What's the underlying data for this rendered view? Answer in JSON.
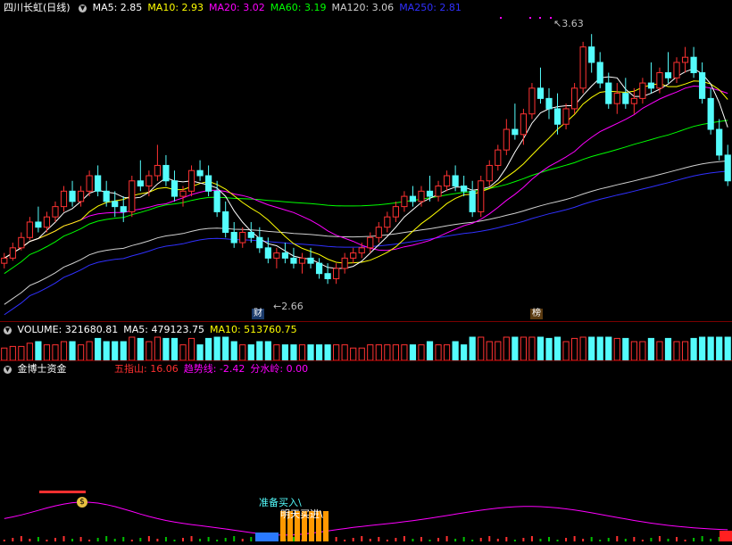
{
  "stock": {
    "name": "四川长虹",
    "period": "(日线)"
  },
  "price_legend": [
    {
      "label": "MA5: 2.85",
      "color": "#ffffff"
    },
    {
      "label": "MA10: 2.93",
      "color": "#ffff00"
    },
    {
      "label": "MA20: 3.02",
      "color": "#ff00ff"
    },
    {
      "label": "MA60: 3.19",
      "color": "#00ff00"
    },
    {
      "label": "MA120: 3.06",
      "color": "#d0d0d0"
    },
    {
      "label": "MA250: 2.81",
      "color": "#3030ff"
    }
  ],
  "volume_legend": [
    {
      "label": "VOLUME: 321680.81",
      "color": "#ffffff"
    },
    {
      "label": "MA5: 479123.75",
      "color": "#ffffff"
    },
    {
      "label": "MA10: 513760.75",
      "color": "#ffff00"
    }
  ],
  "indicator": {
    "name": "金博士资金",
    "items": [
      {
        "label": "五指山: 16.06",
        "color": "#ff3030"
      },
      {
        "label": "趋势线: -2.42",
        "color": "#ff00ff"
      },
      {
        "label": "分水岭: 0.00",
        "color": "#ff00ff"
      }
    ],
    "signals": {
      "prepare_buy": "准备买入",
      "tomorrow_buy": "明天买进"
    }
  },
  "annotations": {
    "high": "3.63",
    "low": "2.66",
    "badge_cai": "财",
    "badge_bang": "榜"
  },
  "colors": {
    "up": "#ff3232",
    "down": "#54fcfc",
    "background": "#000000"
  },
  "chart_data": {
    "type": "candlestick",
    "high_label": 3.63,
    "low_label": 2.66,
    "ma_last": {
      "MA5": 2.85,
      "MA10": 2.93,
      "MA20": 3.02,
      "MA60": 3.19,
      "MA120": 3.06,
      "MA250": 2.81
    },
    "volume_last": 321680.81,
    "volume_ma5": 479123.75,
    "volume_ma10": 513760.75,
    "candles": [
      [
        2.74,
        2.78,
        2.72,
        2.76
      ],
      [
        2.76,
        2.82,
        2.75,
        2.8
      ],
      [
        2.8,
        2.86,
        2.79,
        2.84
      ],
      [
        2.84,
        2.92,
        2.83,
        2.9
      ],
      [
        2.9,
        2.96,
        2.86,
        2.88
      ],
      [
        2.88,
        2.94,
        2.86,
        2.92
      ],
      [
        2.92,
        2.98,
        2.9,
        2.96
      ],
      [
        2.96,
        3.04,
        2.94,
        3.02
      ],
      [
        3.02,
        3.06,
        2.96,
        2.98
      ],
      [
        2.98,
        3.04,
        2.96,
        3.02
      ],
      [
        3.02,
        3.1,
        3.0,
        3.08
      ],
      [
        3.08,
        3.12,
        3.0,
        3.02
      ],
      [
        3.02,
        3.06,
        2.96,
        2.98
      ],
      [
        2.98,
        3.02,
        2.92,
        2.96
      ],
      [
        2.96,
        3.0,
        2.9,
        2.94
      ],
      [
        2.94,
        3.08,
        2.92,
        3.06
      ],
      [
        3.06,
        3.14,
        3.02,
        3.04
      ],
      [
        3.04,
        3.1,
        3.0,
        3.08
      ],
      [
        3.08,
        3.2,
        3.06,
        3.12
      ],
      [
        3.12,
        3.16,
        3.04,
        3.06
      ],
      [
        3.06,
        3.1,
        2.98,
        3.0
      ],
      [
        3.0,
        3.04,
        2.96,
        3.02
      ],
      [
        3.02,
        3.12,
        3.0,
        3.1
      ],
      [
        3.1,
        3.14,
        3.06,
        3.08
      ],
      [
        3.08,
        3.12,
        3.0,
        3.02
      ],
      [
        3.02,
        3.06,
        2.92,
        2.94
      ],
      [
        2.94,
        2.98,
        2.84,
        2.86
      ],
      [
        2.86,
        2.9,
        2.8,
        2.82
      ],
      [
        2.82,
        2.88,
        2.8,
        2.86
      ],
      [
        2.86,
        2.9,
        2.82,
        2.84
      ],
      [
        2.84,
        2.88,
        2.78,
        2.8
      ],
      [
        2.8,
        2.84,
        2.74,
        2.76
      ],
      [
        2.76,
        2.8,
        2.72,
        2.78
      ],
      [
        2.78,
        2.82,
        2.74,
        2.76
      ],
      [
        2.76,
        2.8,
        2.72,
        2.74
      ],
      [
        2.74,
        2.78,
        2.7,
        2.76
      ],
      [
        2.76,
        2.8,
        2.72,
        2.74
      ],
      [
        2.74,
        2.76,
        2.68,
        2.7
      ],
      [
        2.7,
        2.74,
        2.66,
        2.68
      ],
      [
        2.68,
        2.74,
        2.66,
        2.72
      ],
      [
        2.72,
        2.78,
        2.7,
        2.76
      ],
      [
        2.76,
        2.8,
        2.74,
        2.78
      ],
      [
        2.78,
        2.82,
        2.76,
        2.8
      ],
      [
        2.8,
        2.86,
        2.78,
        2.84
      ],
      [
        2.84,
        2.9,
        2.82,
        2.88
      ],
      [
        2.88,
        2.94,
        2.86,
        2.92
      ],
      [
        2.92,
        2.98,
        2.9,
        2.96
      ],
      [
        2.96,
        3.02,
        2.94,
        3.0
      ],
      [
        3.0,
        3.04,
        2.96,
        2.98
      ],
      [
        2.98,
        3.04,
        2.96,
        3.02
      ],
      [
        3.02,
        3.08,
        2.98,
        3.0
      ],
      [
        3.0,
        3.06,
        2.98,
        3.04
      ],
      [
        3.04,
        3.1,
        3.02,
        3.08
      ],
      [
        3.08,
        3.12,
        3.02,
        3.04
      ],
      [
        3.04,
        3.08,
        3.0,
        3.02
      ],
      [
        3.02,
        3.06,
        2.92,
        2.94
      ],
      [
        2.94,
        3.08,
        2.92,
        3.06
      ],
      [
        3.06,
        3.14,
        3.04,
        3.12
      ],
      [
        3.12,
        3.2,
        3.1,
        3.18
      ],
      [
        3.18,
        3.3,
        3.16,
        3.26
      ],
      [
        3.26,
        3.36,
        3.22,
        3.24
      ],
      [
        3.24,
        3.34,
        3.2,
        3.32
      ],
      [
        3.32,
        3.44,
        3.3,
        3.42
      ],
      [
        3.42,
        3.5,
        3.36,
        3.38
      ],
      [
        3.38,
        3.42,
        3.3,
        3.34
      ],
      [
        3.34,
        3.4,
        3.24,
        3.28
      ],
      [
        3.28,
        3.36,
        3.26,
        3.34
      ],
      [
        3.34,
        3.44,
        3.32,
        3.42
      ],
      [
        3.42,
        3.6,
        3.4,
        3.58
      ],
      [
        3.58,
        3.63,
        3.48,
        3.52
      ],
      [
        3.52,
        3.56,
        3.42,
        3.44
      ],
      [
        3.44,
        3.48,
        3.34,
        3.36
      ],
      [
        3.36,
        3.44,
        3.32,
        3.4
      ],
      [
        3.4,
        3.46,
        3.34,
        3.36
      ],
      [
        3.36,
        3.42,
        3.32,
        3.38
      ],
      [
        3.38,
        3.46,
        3.36,
        3.44
      ],
      [
        3.44,
        3.52,
        3.4,
        3.42
      ],
      [
        3.42,
        3.5,
        3.4,
        3.48
      ],
      [
        3.48,
        3.56,
        3.44,
        3.46
      ],
      [
        3.46,
        3.54,
        3.44,
        3.52
      ],
      [
        3.52,
        3.58,
        3.48,
        3.54
      ],
      [
        3.54,
        3.58,
        3.46,
        3.48
      ],
      [
        3.48,
        3.52,
        3.36,
        3.38
      ],
      [
        3.38,
        3.42,
        3.24,
        3.26
      ],
      [
        3.26,
        3.3,
        3.14,
        3.16
      ],
      [
        3.16,
        3.2,
        3.04,
        3.06
      ]
    ]
  }
}
